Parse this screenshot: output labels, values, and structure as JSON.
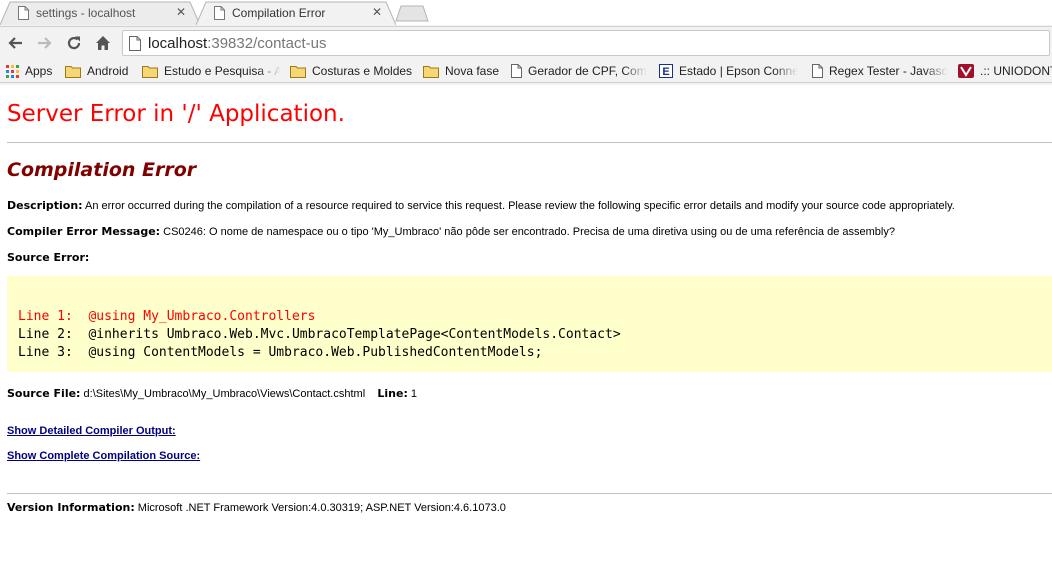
{
  "browser": {
    "tabs": [
      {
        "title": "settings - localhost",
        "close": "✕"
      },
      {
        "title": "Compilation Error",
        "close": "✕"
      }
    ],
    "url_host": "localhost",
    "url_rest": ":39832/contact-us",
    "bookmarks": [
      {
        "label": "Apps",
        "icon": "apps-grid-icon"
      },
      {
        "label": "Android",
        "icon": "folder-icon"
      },
      {
        "label": "Estudo e Pesquisa - A",
        "icon": "folder-icon"
      },
      {
        "label": "Costuras e Moldes",
        "icon": "folder-icon"
      },
      {
        "label": "Nova fase",
        "icon": "folder-icon"
      },
      {
        "label": "Gerador de CPF, Com",
        "icon": "page-icon"
      },
      {
        "label": "Estado | Epson Conne",
        "icon": "epson-e-icon"
      },
      {
        "label": "Regex Tester - Javascr",
        "icon": "page-icon"
      },
      {
        "label": ".:: UNIODONT",
        "icon": "uniodonto-icon"
      }
    ]
  },
  "error_page": {
    "heading": "Server Error in '/' Application.",
    "subheading": "Compilation Error",
    "description_label": "Description:",
    "description_text": " An error occurred during the compilation of a resource required to service this request. Please review the following specific error details and modify your source code appropriately.",
    "message_label": "Compiler Error Message:",
    "message_text": " CS0246: O nome de namespace ou o tipo 'My_Umbraco' não pôde ser encontrado. Precisa de uma diretiva using ou de uma referência de assembly?",
    "source_error_label": "Source Error:",
    "code_lines": [
      {
        "prefix": "Line 1:  ",
        "code": "@using My_Umbraco.Controllers"
      },
      {
        "prefix": "Line 2:  ",
        "code": "@inherits Umbraco.Web.Mvc.UmbracoTemplatePage<ContentModels.Contact>"
      },
      {
        "prefix": "Line 3:  ",
        "code": "@using ContentModels = Umbraco.Web.PublishedContentModels;"
      }
    ],
    "source_file_label": "Source File:",
    "source_file_value": " d:\\Sites\\My_Umbraco\\My_Umbraco\\Views\\Contact.cshtml",
    "line_label": "Line:",
    "line_value": " 1",
    "link_detailed": "Show Detailed Compiler Output:",
    "link_complete": "Show Complete Compilation Source:",
    "version_label": "Version Information:",
    "version_text": " Microsoft .NET Framework Version:4.0.30319; ASP.NET Version:4.6.1073.0"
  },
  "colors": {
    "heading": "#ff0000",
    "subheading": "#800000",
    "code_bg": "#ffffcc",
    "link": "#000080"
  }
}
